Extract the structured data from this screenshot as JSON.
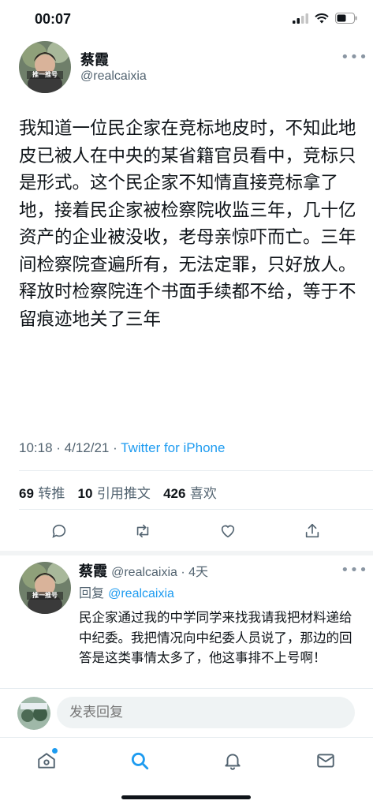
{
  "status_bar": {
    "time": "00:07"
  },
  "tweet": {
    "author_name": "蔡霞",
    "author_handle": "@realcaixia",
    "avatar_badge": "推一推号",
    "text": "我知道一位民企家在竞标地皮时，不知此地皮已被人在中央的某省籍官员看中，竞标只是形式。这个民企家不知情直接竞标拿了地，接着民企家被检察院收监三年，几十亿资产的企业被没收，老母亲惊吓而亡。三年间检察院查遍所有，无法定罪，只好放人。释放时检察院连个书面手续都不给，等于不留痕迹地关了三年",
    "timestamp": "10:18 · 4/12/21 · ",
    "source": "Twitter for iPhone",
    "retweets_count": "69",
    "retweets_label": "转推",
    "quotes_count": "10",
    "quotes_label": "引用推文",
    "likes_count": "426",
    "likes_label": "喜欢"
  },
  "reply": {
    "author_name": "蔡霞",
    "author_handle": "@realcaixia · 4天",
    "avatar_badge": "推一推号",
    "reply_to_prefix": "回复 ",
    "reply_to_handle": "@realcaixia",
    "text": "民企家通过我的中学同学来找我请我把材料递给中纪委。我把情况向中纪委人员说了，那边的回答是这类事情太多了，他这事排不上号啊！"
  },
  "composer": {
    "placeholder": "发表回复"
  },
  "tabs": [
    "home-icon",
    "search-icon",
    "notifications-icon",
    "messages-icon"
  ],
  "colors": {
    "accent": "#1d9bf0",
    "text": "#0f1419",
    "muted": "#536471",
    "divider": "#e6ecf0"
  }
}
